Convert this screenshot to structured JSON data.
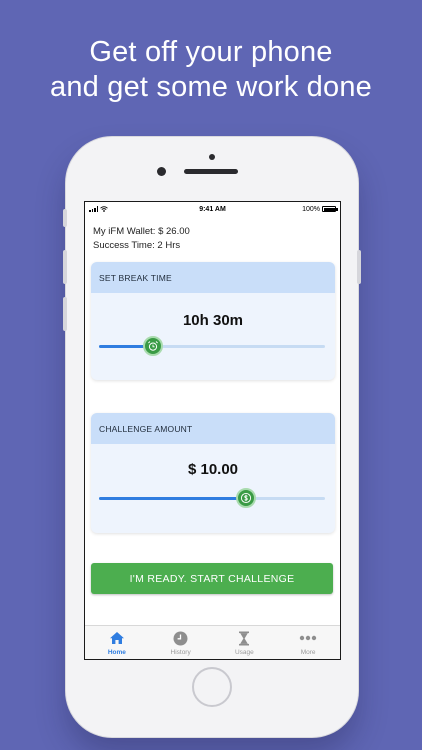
{
  "headline": {
    "line1": "Get off your phone",
    "line2": "and get some work done"
  },
  "status_bar": {
    "time": "9:41 AM",
    "battery": "100%"
  },
  "wallet": {
    "label": "My iFM Wallet:",
    "value": "$ 26.00"
  },
  "success": {
    "label": "Success Time:",
    "value": "2 Hrs"
  },
  "break_card": {
    "title": "SET BREAK TIME",
    "value": "10h 30m",
    "slider_fraction": 0.24
  },
  "amount_card": {
    "title": "CHALLENGE AMOUNT",
    "value": "$ 10.00",
    "slider_fraction": 0.65
  },
  "start_button": {
    "label": "I'M READY. START CHALLENGE"
  },
  "tabs": [
    {
      "label": "Home",
      "icon": "home-icon",
      "active": true
    },
    {
      "label": "History",
      "icon": "clock-icon",
      "active": false
    },
    {
      "label": "Usage",
      "icon": "hourglass-icon",
      "active": false
    },
    {
      "label": "More",
      "icon": "more-icon",
      "active": false
    }
  ],
  "colors": {
    "background": "#5f66b4",
    "accent_blue": "#2f7de0",
    "accent_green": "#4cae4f",
    "card_header": "#c9def9"
  }
}
